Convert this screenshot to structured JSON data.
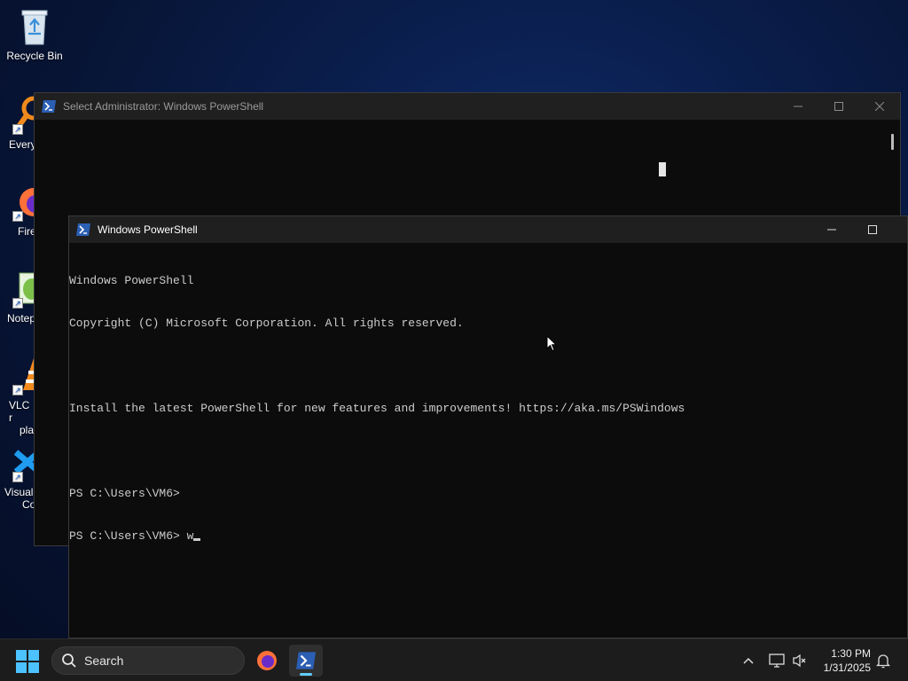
{
  "desktop": {
    "icons": [
      {
        "label": "Recycle Bin",
        "icon": "recycle-bin-icon"
      },
      {
        "label": "Every",
        "icon": "everything-search-icon"
      },
      {
        "label": "Fire",
        "icon": "firefox-icon"
      },
      {
        "label": "Notep",
        "icon": "notepad-plus-plus-icon"
      },
      {
        "label": "VLC r",
        "label2": "pla",
        "icon": "vlc-icon"
      },
      {
        "label": "Visual",
        "label2": "Co",
        "icon": "vscode-icon"
      }
    ]
  },
  "back_window": {
    "title": "Select Administrator: Windows PowerShell"
  },
  "front_window": {
    "title": "Windows PowerShell",
    "lines": [
      "Windows PowerShell",
      "Copyright (C) Microsoft Corporation. All rights reserved.",
      "",
      "Install the latest PowerShell for new features and improvements! https://aka.ms/PSWindows",
      "",
      "PS C:\\Users\\VM6>",
      "PS C:\\Users\\VM6> w"
    ]
  },
  "taskbar": {
    "search_label": "Search",
    "time": "1:30 PM",
    "date": "1/31/2025",
    "accent_color": "#60cdff"
  },
  "colors": {
    "console_bg": "#0c0c0c",
    "console_text": "#cccccc",
    "desktop_bg": "#071434"
  }
}
